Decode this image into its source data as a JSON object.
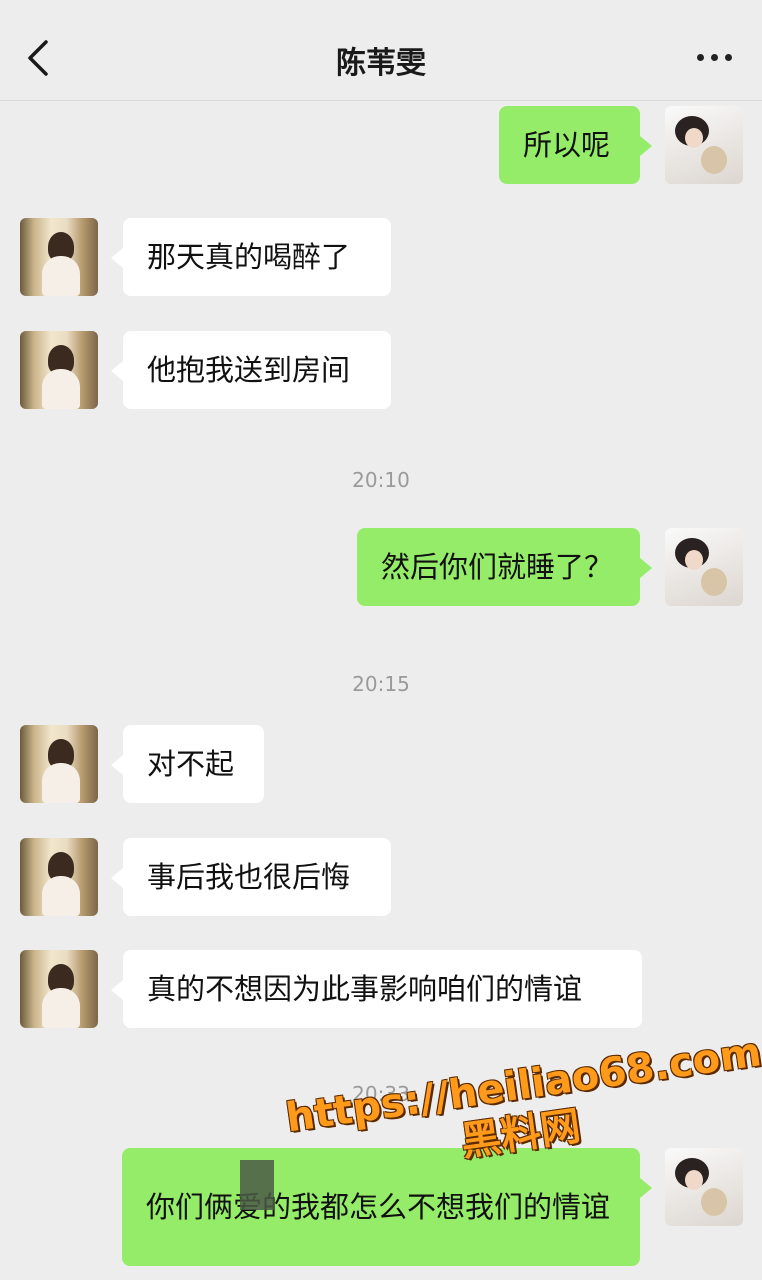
{
  "header": {
    "title": "陈苇雯"
  },
  "messages": [
    {
      "text": "所以呢"
    },
    {
      "text": "那天真的喝醉了"
    },
    {
      "text": "他抱我送到房间"
    },
    {
      "time": "20:10"
    },
    {
      "text": "然后你们就睡了？"
    },
    {
      "time": "20:15"
    },
    {
      "text": "对不起"
    },
    {
      "text": "事后我也很后悔"
    },
    {
      "text": "真的不想因为此事影响咱们的情谊"
    },
    {
      "time": "20:33"
    },
    {
      "text": "你们俩爱的我都怎么不想我们的情谊"
    }
  ],
  "watermark": {
    "url": "https://heiliao68.com",
    "cn": "黑料网"
  },
  "colors": {
    "outgoing_bubble": "#95ec69",
    "incoming_bubble": "#ffffff",
    "background": "#ededed"
  }
}
